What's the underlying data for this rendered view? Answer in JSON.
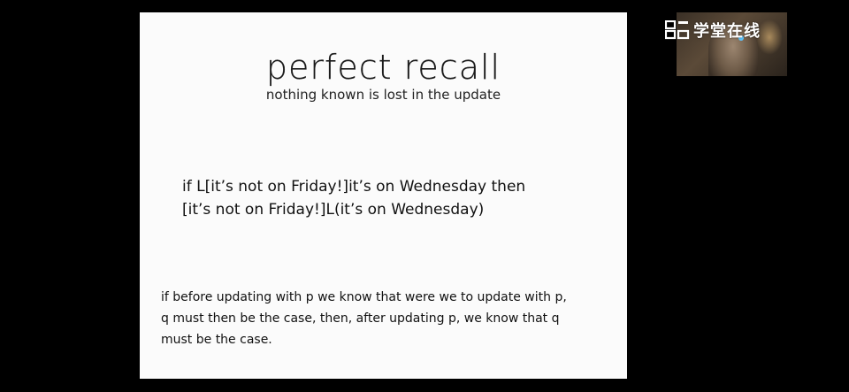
{
  "slide": {
    "title": "perfect recall",
    "subtitle": "nothing known is lost in the update",
    "formula_lines": [
      "if L[it’s not on Friday!]it’s on Wednesday then",
      "[it’s not on Friday!]L(it’s on Wednesday)"
    ],
    "explanation_lines": [
      "if before updating with p we know that were we to update with p,",
      "q must then be the case, then, after updating p, we know that q",
      "must be the case."
    ]
  },
  "overlay": {
    "logo_text": "学堂在线",
    "logo_icon": "xuetangx-logo-icon"
  }
}
